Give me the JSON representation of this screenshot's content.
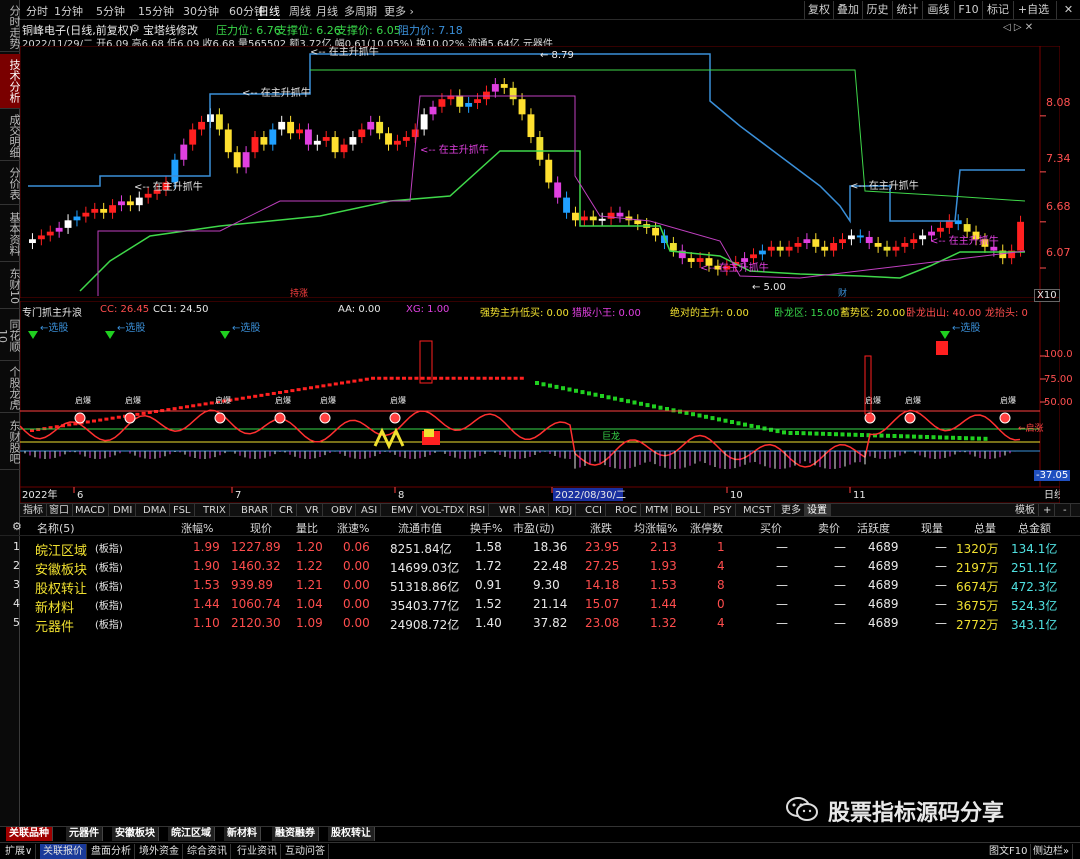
{
  "sidebar": {
    "tabs": [
      "分时走势",
      "技术分析",
      "成交明细",
      "分价表",
      "基本资料",
      "东财10",
      "同花顺10",
      "个股龙虎",
      "东财股吧"
    ],
    "active": 1
  },
  "topbar": {
    "periods": [
      "分时",
      "1分钟",
      "5分钟",
      "15分钟",
      "30分钟",
      "60分钟",
      "日线",
      "周线",
      "月线",
      "多周期",
      "更多 ›"
    ],
    "active_period": "日线",
    "buttons": [
      "复权",
      "叠加",
      "历史",
      "统计",
      "画线",
      "F10",
      "标记",
      "+自选"
    ]
  },
  "main_chart": {
    "title": "铜峰电子(日线,前复权)",
    "indicator": "宝塔线修改",
    "pressure": "压力位: 6.76",
    "support": "支撑位: 6.26",
    "bracing": "支撑价: 6.05",
    "resistance": "阻力价: 7.18",
    "info_line": "2022/11/29/二 开6.09 高6.68 低6.09 收6.68 量565502 额3.72亿 幅0.61(10.05%) 换10.02% 流通5.64亿 元器件",
    "y_axis": [
      "8.08",
      "7.34",
      "6.68",
      "6.07"
    ],
    "annotations": {
      "top_price": "8.79",
      "low_price": "5.00",
      "label_main": "在主升抓牛",
      "arrow_label": "<-- 在主升抓牛",
      "tag_jian": "持涨",
      "tag_cai": "财"
    },
    "multiplier": "X10"
  },
  "indicator_pane": {
    "title": "专门抓主升浪",
    "cc": "CC: 26.45",
    "cc1": "CC1: 24.50",
    "aa": "AA: 0.00",
    "xg": "XG: 1.00",
    "strong": "强势主升低买: 0.00",
    "retail": "猎股小王: 0.00",
    "absolute": "绝对的主升: 0.00",
    "wolong": "卧龙区: 15.00",
    "xushi": "蓄势区: 20.00",
    "longchu": "卧龙出山: 40.00",
    "longtai": "龙抬头: 0",
    "y_axis": [
      "100.0",
      "75.00",
      "50.00"
    ],
    "bottom_value": "-37.05",
    "buy_label": "选股",
    "start_label": "启爆",
    "ready_label": "启涨",
    "dragon_label": "巨龙"
  },
  "time_axis": {
    "labels": [
      "2022年",
      "6",
      "7",
      "8",
      "2022/08/30/二",
      "10",
      "11"
    ],
    "period": "日线"
  },
  "indicator_tabs": [
    "指标",
    "窗口",
    "MACD",
    "DMI",
    "DMA",
    "FSL",
    "TRIX",
    "BRAR",
    "CR",
    "VR",
    "OBV",
    "ASI",
    "EMV",
    "VOL-TDX",
    "RSI",
    "WR",
    "SAR",
    "KDJ",
    "CCI",
    "ROC",
    "MTM",
    "BOLL",
    "PSY",
    "MCST",
    "更多",
    "设置"
  ],
  "indicator_tabs_right": [
    "模板",
    "+",
    "-"
  ],
  "table": {
    "headers": [
      "名称(5)",
      "涨幅%",
      "现价",
      "量比",
      "涨速%",
      "流通市值",
      "换手%",
      "市盈(动)",
      "涨跌",
      "均涨幅%",
      "涨停数",
      "买价",
      "卖价",
      "活跃度",
      "现量",
      "总量",
      "总金额"
    ],
    "rows": [
      {
        "idx": "1",
        "name": "皖江区域",
        "tag": "(板指)",
        "chg": "1.99",
        "price": "1227.89",
        "vr": "1.20",
        "speed": "0.06",
        "mcap": "8251.84亿",
        "turn": "1.58",
        "pe": "18.36",
        "diff": "23.95",
        "avg": "2.13",
        "limit": "1",
        "bid": "—",
        "ask": "—",
        "act": "4689",
        "cur": "—",
        "vol": "1320万",
        "amt": "134.1亿"
      },
      {
        "idx": "2",
        "name": "安徽板块",
        "tag": "(板指)",
        "chg": "1.90",
        "price": "1460.32",
        "vr": "1.22",
        "speed": "0.00",
        "mcap": "14699.03亿",
        "turn": "1.72",
        "pe": "22.48",
        "diff": "27.25",
        "avg": "1.93",
        "limit": "4",
        "bid": "—",
        "ask": "—",
        "act": "4689",
        "cur": "—",
        "vol": "2197万",
        "amt": "251.1亿"
      },
      {
        "idx": "3",
        "name": "股权转让",
        "tag": "(板指)",
        "chg": "1.53",
        "price": "939.89",
        "vr": "1.21",
        "speed": "0.00",
        "mcap": "51318.86亿",
        "turn": "0.91",
        "pe": "9.30",
        "diff": "14.18",
        "avg": "1.53",
        "limit": "8",
        "bid": "—",
        "ask": "—",
        "act": "4689",
        "cur": "—",
        "vol": "6674万",
        "amt": "472.3亿"
      },
      {
        "idx": "4",
        "name": "新材料",
        "tag": "(板指)",
        "chg": "1.44",
        "price": "1060.74",
        "vr": "1.04",
        "speed": "0.00",
        "mcap": "35403.77亿",
        "turn": "1.52",
        "pe": "21.14",
        "diff": "15.07",
        "avg": "1.44",
        "limit": "0",
        "bid": "—",
        "ask": "—",
        "act": "4689",
        "cur": "—",
        "vol": "3675万",
        "amt": "524.3亿"
      },
      {
        "idx": "5",
        "name": "元器件",
        "tag": "(板指)",
        "chg": "1.10",
        "price": "2120.30",
        "vr": "1.09",
        "speed": "0.00",
        "mcap": "24908.72亿",
        "turn": "1.40",
        "pe": "37.82",
        "diff": "23.08",
        "avg": "1.32",
        "limit": "4",
        "bid": "—",
        "ask": "—",
        "act": "4689",
        "cur": "—",
        "vol": "2772万",
        "amt": "343.1亿"
      }
    ]
  },
  "bottom_tabs": [
    "关联品种",
    "元器件",
    "安徽板块",
    "皖江区域",
    "新材料",
    "融资融券",
    "股权转让"
  ],
  "statusbar": {
    "items": [
      "扩展∨",
      "关联报价",
      "盘面分析",
      "境外资金",
      "综合资讯",
      "行业资讯",
      "互动问答"
    ],
    "right": [
      "图文F10",
      "侧边栏»"
    ]
  },
  "watermark": "股票指标源码分享",
  "colors": {
    "up": "#ff3333",
    "down": "#00c8c8",
    "yellow": "#f0e030",
    "blue_line": "#3a8fd8",
    "green_line": "#3fd84a",
    "magenta_line": "#c040c0"
  }
}
